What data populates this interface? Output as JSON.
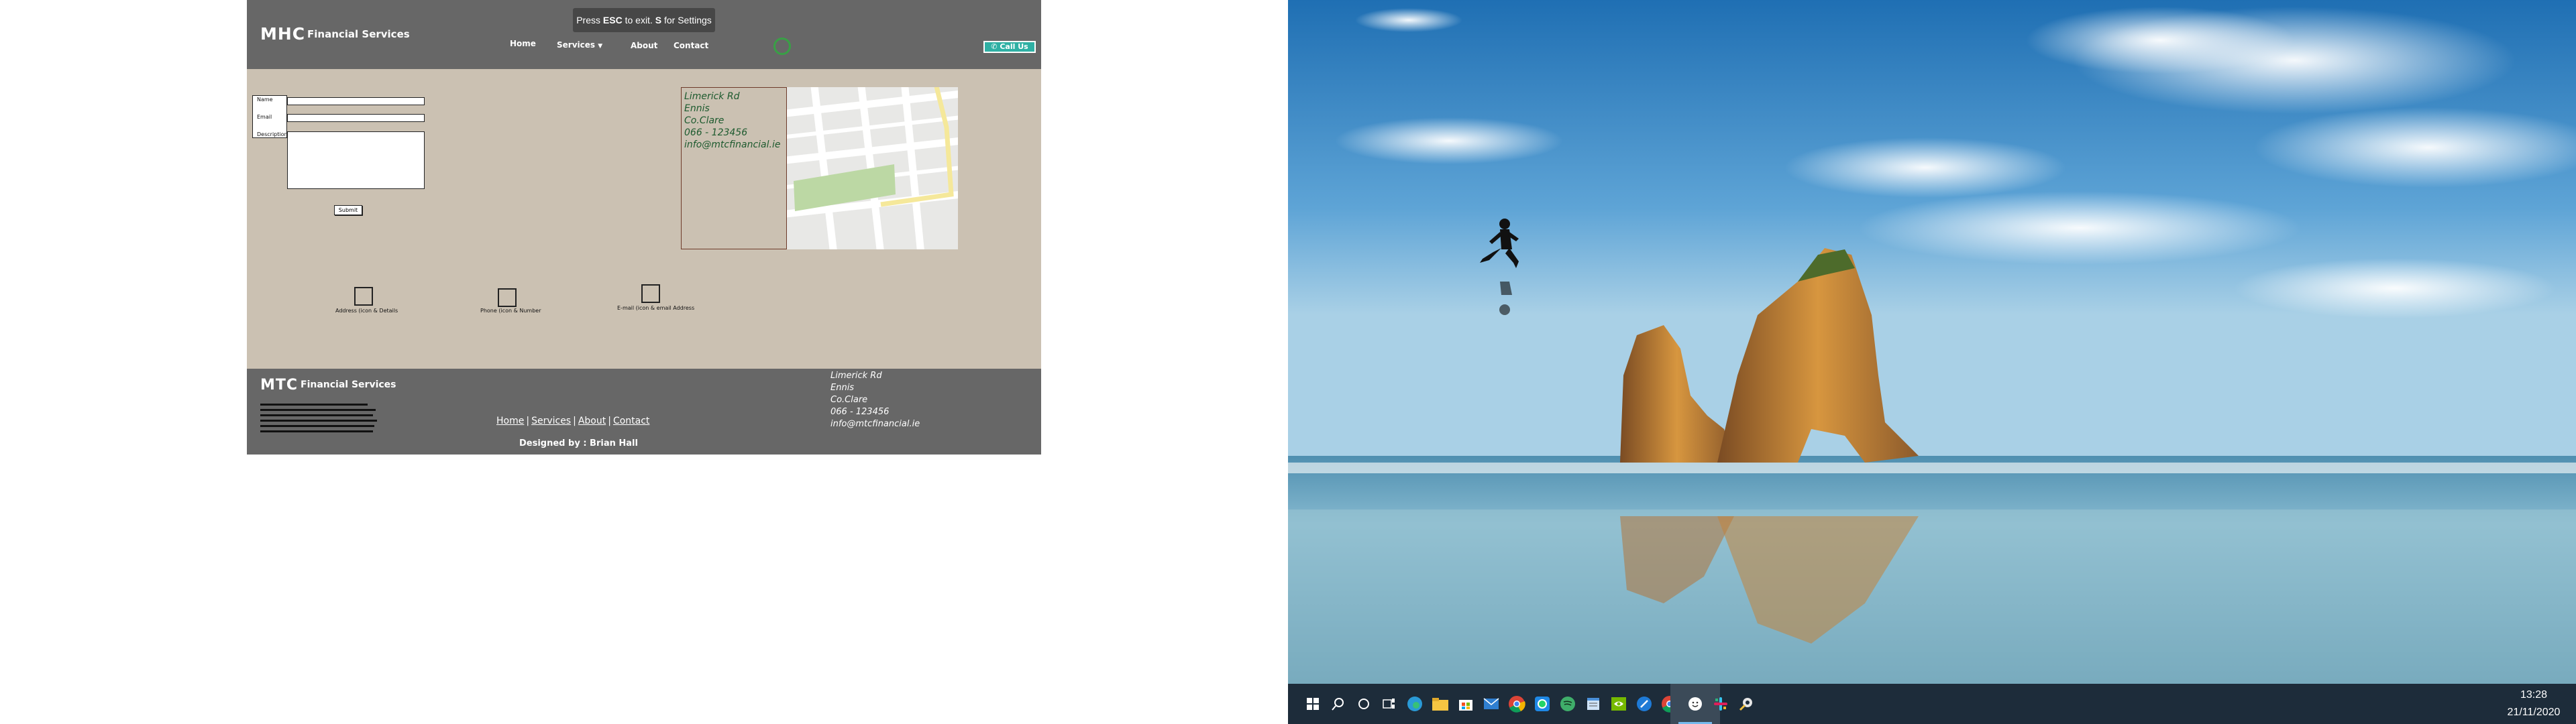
{
  "overlay": {
    "esc_prefix": "Press ",
    "esc_key": "ESC",
    "esc_middle": " to exit. ",
    "settings_key": "S",
    "esc_suffix": " for Settings"
  },
  "header": {
    "logo": "MHC",
    "company": "Financial Services",
    "nav": [
      "Home",
      "Services",
      "About",
      "Contact"
    ],
    "call_button": "Call Us"
  },
  "form": {
    "name_label": "Name",
    "email_label": "Email",
    "description_label": "Description",
    "name_value": "",
    "email_value": "",
    "description_value": "",
    "submit_label": "Submit"
  },
  "address": {
    "lines": [
      "Limerick Rd",
      "Ennis",
      "Co.Clare",
      "066 - 123456",
      "info@mtcfinancial.ie"
    ]
  },
  "info_row": {
    "items": [
      {
        "label": "Address (icon & Details"
      },
      {
        "label": "Phone (icon & Number"
      },
      {
        "label": "E-mail (icon & email Address"
      }
    ]
  },
  "footer": {
    "logo": "MTC",
    "company": "Financial Services",
    "links": [
      "Home",
      "Services",
      "About",
      "Contact"
    ],
    "designed_by": "Designed by : Brian Hall",
    "address_lines": [
      "Limerick Rd",
      "Ennis",
      "Co.Clare",
      "066 - 123456",
      "info@mtcfinancial.ie"
    ]
  },
  "desktop": {
    "taskbar_icons": [
      "start-icon",
      "search-icon",
      "cortana-icon",
      "task-view-icon",
      "edge-icon",
      "file-explorer-icon",
      "store-icon",
      "mail-icon",
      "chrome-icon",
      "whatsapp-icon",
      "spotify-icon",
      "notepad-icon",
      "nvidia-icon",
      "browser-icon",
      "chrome-alt-icon",
      "smiley-app-icon",
      "slack-icon",
      "settings-tool-icon"
    ],
    "active_icon": "smiley-app-icon",
    "time": "13:28",
    "date": "21/11/2020"
  },
  "colors": {
    "header_bg": "#676767",
    "page_bg": "#cbc1b2",
    "accent": "#2fb0a4",
    "address_text": "#1d5a2e",
    "taskbar_bg": "#1d2c3a"
  }
}
